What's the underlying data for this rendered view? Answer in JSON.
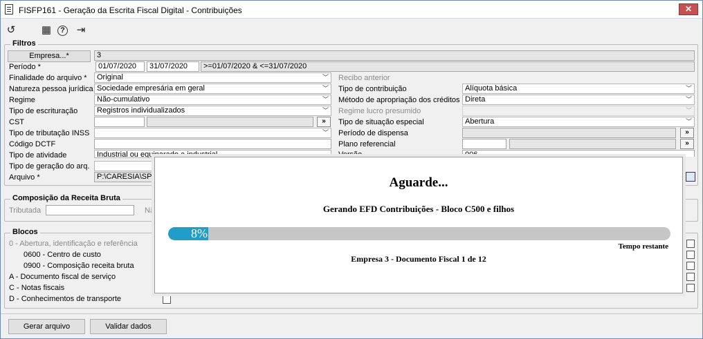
{
  "window": {
    "title": "FISFP161 - Geração da Escrita Fiscal Digital - Contribuições",
    "close": "✕"
  },
  "toolbar": {
    "undo": "↺",
    "calendar": "▦",
    "help": "?",
    "exit": "⇥"
  },
  "filtros": {
    "title": "Filtros",
    "empresa_btn": "Empresa...*",
    "empresa_val": "3",
    "periodo_lbl": "Período *",
    "periodo_de": "01/07/2020",
    "periodo_ate": "31/07/2020",
    "periodo_expr": ">=01/07/2020 & <=31/07/2020",
    "finalidade_lbl": "Finalidade do arquivo *",
    "finalidade_val": "Original",
    "recibo_lbl": "Recibo anterior",
    "natureza_lbl": "Natureza pessoa jurídica",
    "natureza_val": "Sociedade empresária em geral",
    "tipo_contrib_lbl": "Tipo de contribuição",
    "tipo_contrib_val": "Alíquota básica",
    "regime_lbl": "Regime",
    "regime_val": "Não-cumulativo",
    "metodo_lbl": "Método de apropriação dos créditos",
    "metodo_val": "Direta",
    "escrituracao_lbl": "Tipo de escrituração",
    "escrituracao_val": "Registros individualizados",
    "regime_lucro_lbl": "Regime lucro presumido",
    "cst_lbl": "CST",
    "situacao_lbl": "Tipo de situação especial",
    "situacao_val": "Abertura",
    "inss_lbl": "Tipo de tributação INSS",
    "dispensa_lbl": "Período de dispensa",
    "dctf_lbl": "Código DCTF",
    "plano_lbl": "Plano referencial",
    "atividade_lbl": "Tipo de atividade",
    "atividade_val": "Industrial ou equiparado a industrial",
    "versao_lbl": "Versão",
    "versao_val": "006",
    "geracao_lbl": "Tipo de geração do arq.",
    "arquivo_lbl": "Arquivo *",
    "arquivo_val": "P:\\CARESIA\\SPED",
    "search_glyph": "»"
  },
  "composicao": {
    "title": "Composição da Receita Bruta",
    "tributada_lbl": "Tributada",
    "nao_lbl": "Nã"
  },
  "blocos": {
    "title": "Blocos",
    "items": [
      "0 - Abertura, identificação e referência",
      "0600 - Centro de custo",
      "0900 - Composição receita bruta",
      "A - Documento fiscal de serviço",
      "C - Notas fiscais",
      "D - Conhecimentos de transporte"
    ]
  },
  "footer": {
    "gerar": "Gerar arquivo",
    "validar": "Validar dados"
  },
  "progress": {
    "title": "Aguarde...",
    "subtitle": "Gerando EFD Contribuições - Bloco C500 e filhos",
    "percent_text": "8%",
    "percent": 8,
    "remaining": "Tempo restante",
    "document": "Empresa 3 - Documento Fiscal 1 de 12"
  }
}
